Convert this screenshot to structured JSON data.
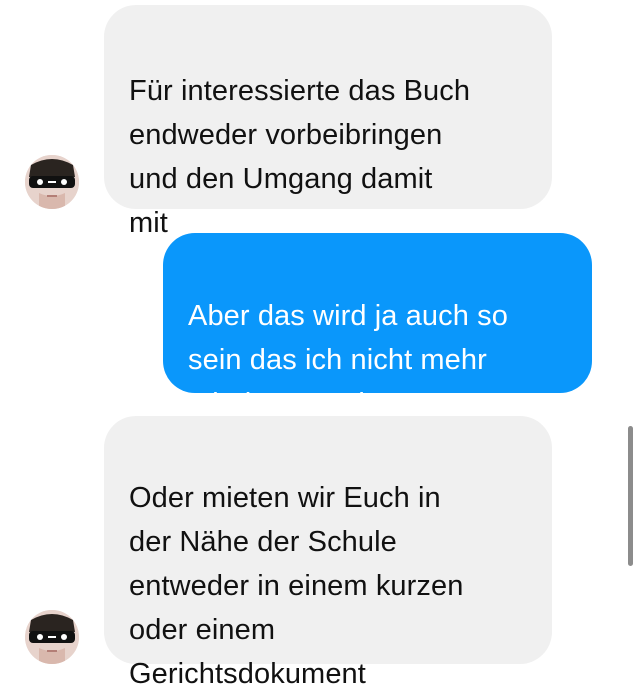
{
  "conversation": {
    "messages": [
      {
        "direction": "incoming",
        "text": "Für interessierte das Buch\nendweder vorbeibringen\nund den Umgang damit\nmit"
      },
      {
        "direction": "outgoing",
        "text": "Aber das wird ja auch so\nsein das ich nicht mehr\nmit dem Bus kommen"
      },
      {
        "direction": "incoming",
        "text": "Oder mieten wir Euch in\nder Nähe der Schule\nentweder in einem kurzen\noder einem\nGerichtsdokument"
      }
    ]
  },
  "colors": {
    "incoming_bubble": "#f0f0f0",
    "outgoing_bubble": "#0a97fb",
    "incoming_text": "#111111",
    "outgoing_text": "#ffffff"
  },
  "icons": {
    "avatar": "masked-face-avatar"
  }
}
